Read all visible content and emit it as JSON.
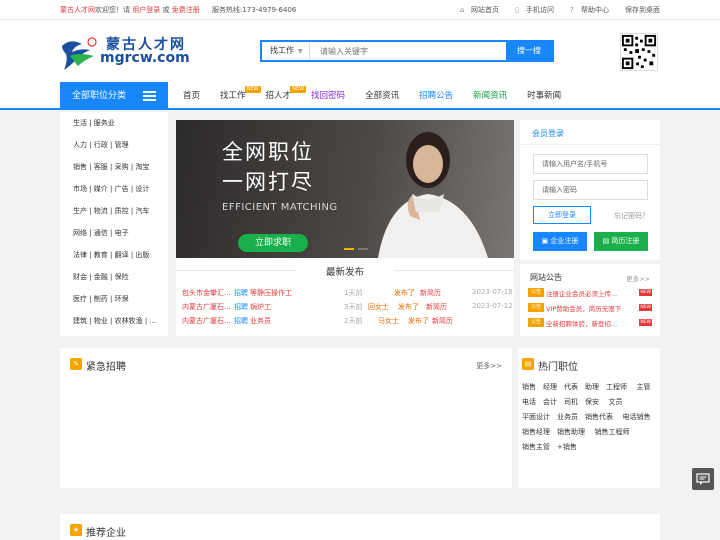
{
  "topbar": {
    "site": "蒙古人才网",
    "welcome": "欢迎您！请",
    "login": "用户登录",
    "or": "或",
    "register": "免费注册",
    "hotline": "服务热线:173-4979-6406",
    "links": [
      "网站首页",
      "手机访问",
      "帮助中心",
      "保存到桌面"
    ]
  },
  "logo": {
    "cn": "蒙古人才网",
    "en": "mgrcw.com"
  },
  "search": {
    "type": "找工作",
    "placeholder": "请输入关键字",
    "button": "搜一搜"
  },
  "nav": {
    "category_button": "全部职位分类",
    "items": [
      "首页",
      "找工作",
      "招人才",
      "找回密码",
      "全部资讯",
      "招聘公告",
      "新闻资讯",
      "时事新闻"
    ],
    "badge": "NEW"
  },
  "sidebar": {
    "items": [
      "生活 | 服务业",
      "人力 | 行政 | 管理",
      "销售 | 客服 | 采购 | 淘宝",
      "市场 | 媒介 | 广告 | 设计",
      "生产 | 物流 | 质控 | 汽车",
      "网络 | 通信 | 电子",
      "法律 | 教育 | 翻译 | 出版",
      "财会 | 金融 | 保险",
      "医疗 | 制药 | 环保",
      "建筑 | 物业 | 农林牧渔 | ..."
    ]
  },
  "banner": {
    "line1": "全网职位",
    "line2": "一网打尽",
    "line3": "EFFICIENT MATCHING",
    "cta": "立即求职"
  },
  "latest": {
    "title": "最新发布",
    "rows": [
      {
        "company": "包头市金攀汇...",
        "tag": "招聘",
        "job": "等静压操作工",
        "time": "1天前",
        "user": "",
        "action": "",
        "date": "2023-07-18"
      },
      {
        "company": "内蒙古广厦石...",
        "tag": "招聘",
        "job": "锅炉工",
        "time": "3天前",
        "user": "回女士",
        "action": "发布了",
        "type": "新简历",
        "date": "2023-07-12"
      },
      {
        "company": "内蒙古广厦石...",
        "tag": "招聘",
        "job": "业务员",
        "time": "2天前",
        "user": "马女士",
        "action": "发布了",
        "type": "新简历",
        "date": ""
      }
    ],
    "top_user": {
      "action": "发布了",
      "type": "新简历"
    }
  },
  "login": {
    "title": "会员登录",
    "username_placeholder": "请输入用户名/手机号",
    "password_placeholder": "请输入密码",
    "login_button": "立即登录",
    "forgot": "忘记密码？",
    "company_register": "企业注册",
    "resume_register": "简历注册"
  },
  "notice": {
    "title": "网站公告",
    "more": "更多>>",
    "items": [
      "注册企业会员必须上传...",
      "VIP赞助会员，简历无限下",
      "全新招聘体验，新登招..."
    ],
    "icon_label": "公告",
    "badge": "NEW"
  },
  "urgent": {
    "title": "紧急招聘",
    "more": "更多>>"
  },
  "hot_jobs": {
    "title": "热门职位",
    "items": [
      "销售",
      "经理",
      "代表",
      "助理",
      "工程师",
      "主管",
      "电话",
      "会计",
      "司机",
      "保安",
      "文员",
      "平面设计",
      "业务员",
      "销售代表",
      "电话销售",
      "销售经理",
      "销售助理",
      "销售工程师",
      "销售主管",
      "+销售"
    ]
  },
  "recommended": {
    "title": "推荐企业"
  },
  "colors": {
    "primary": "#1787fb",
    "red": "#e4393c",
    "orange": "#f4a300",
    "green": "#18b04a"
  }
}
